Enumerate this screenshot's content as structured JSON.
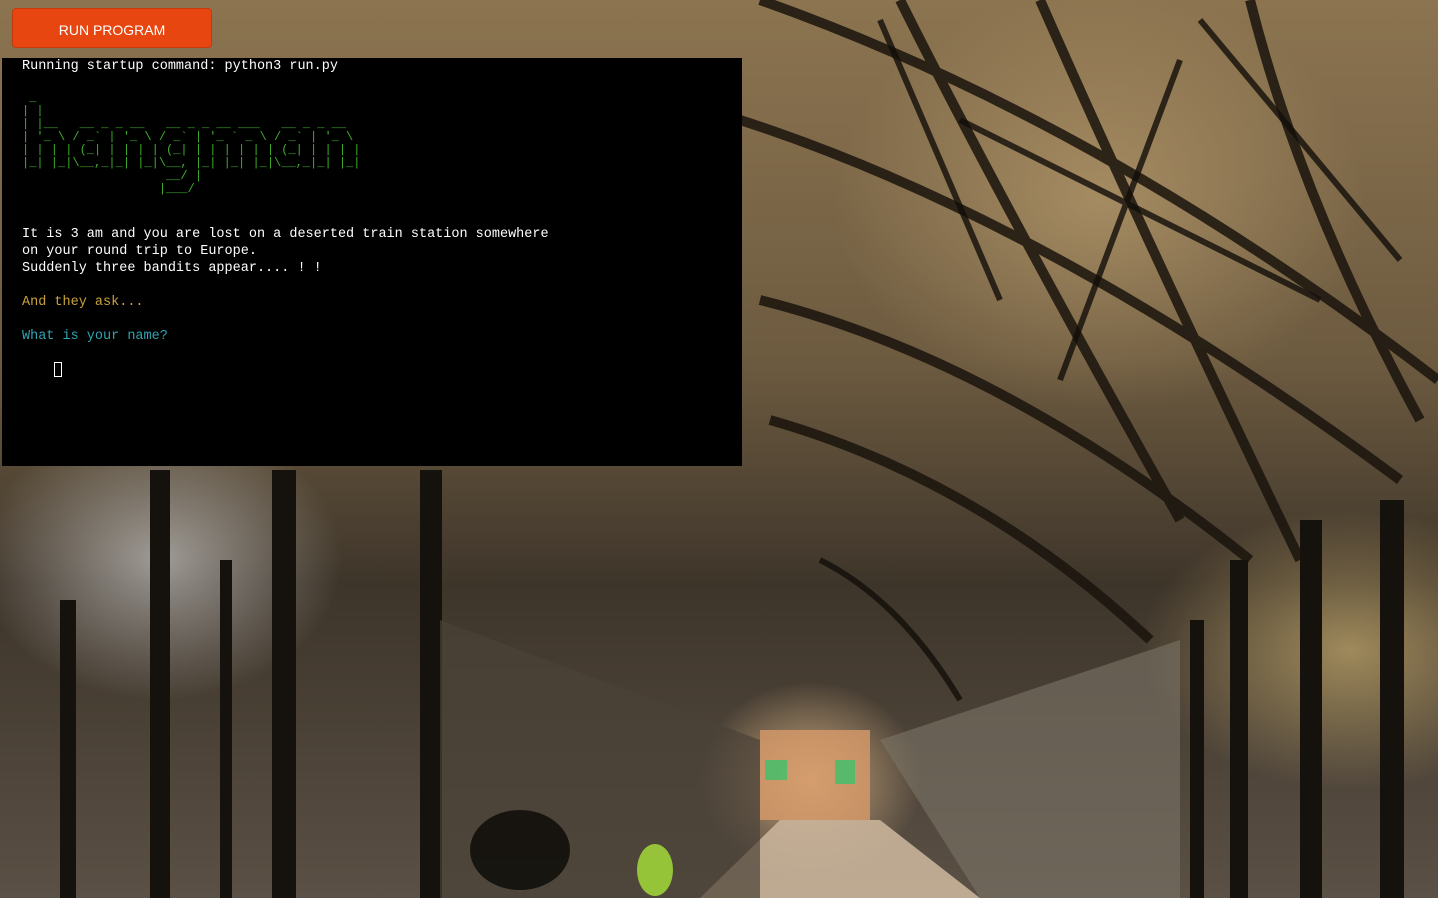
{
  "toolbar": {
    "run_label": "RUN PROGRAM"
  },
  "terminal": {
    "startup_line": "Running startup command: python3 run.py",
    "ascii_title": " _\n| |\n| |__   __ _ _ __   __ _ _ __ ___   __ _ _ __\n| '_ \\ / _` | '_ \\ / _` | '_ ` _ \\ / _` | '_ \\\n| | | | (_| | | | | (_| | | | | | | (_| | | | |\n|_| |_|\\__,_|_| |_|\\__, |_| |_| |_|\\__,_|_| |_|\n                    __/ |\n                   |___/",
    "story_lines": [
      "It is 3 am and you are lost on a deserted train station somewhere",
      "on your round trip to Europe.",
      "Suddenly three bandits appear.... ! !"
    ],
    "prompt_intro": "And they ask...",
    "prompt_question": "What is your name?"
  },
  "colors": {
    "button_bg": "#e84610",
    "ascii_green": "#3fae2a",
    "intro_yellow": "#c9a33a",
    "question_cyan": "#2fa3b0"
  }
}
